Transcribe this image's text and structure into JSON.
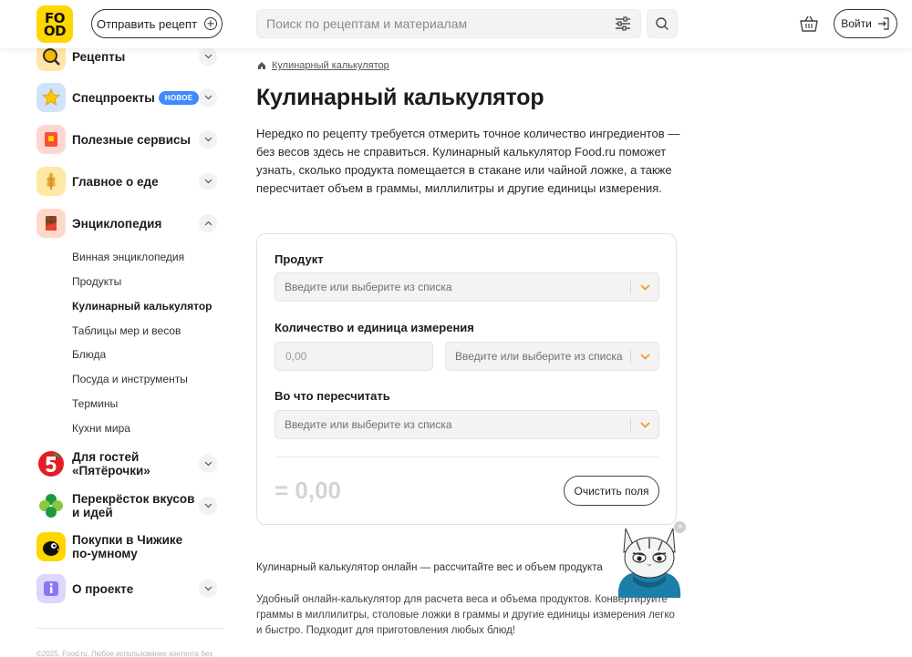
{
  "header": {
    "logo_line1": "FO",
    "logo_line2": "OD",
    "send_recipe_label": "Отправить рецепт",
    "search_placeholder": "Поиск по рецептам и материалам",
    "login_label": "Войти"
  },
  "sidebar": {
    "items": [
      {
        "label": "Рецепты",
        "icon": "recipes-icon"
      },
      {
        "label": "Спецпроекты",
        "icon": "star-icon",
        "badge": "НОВОЕ"
      },
      {
        "label": "Полезные сервисы",
        "icon": "services-icon"
      },
      {
        "label": "Главное о еде",
        "icon": "wheat-icon"
      },
      {
        "label": "Энциклопедия",
        "icon": "chocolate-icon"
      },
      {
        "label_line1": "Для гостей",
        "label_line2": "«Пятёрочки»",
        "icon": "pyaterochka-icon"
      },
      {
        "label_line1": "Перекрёсток вкусов",
        "label_line2": "и идей",
        "icon": "perekrestok-icon"
      },
      {
        "label_line1": "Покупки в Чижике",
        "label_line2": "по-умному",
        "icon": "chizhik-icon"
      },
      {
        "label": "О проекте",
        "icon": "info-icon"
      }
    ],
    "sub_items": [
      "Винная энциклопедия",
      "Продукты",
      "Кулинарный калькулятор",
      "Таблицы мер и весов",
      "Блюда",
      "Посуда и инструменты",
      "Термины",
      "Кухни мира"
    ],
    "copyright": "©2025. Food.ru. Любое использование контента без"
  },
  "main": {
    "breadcrumb": "Кулинарный калькулятор",
    "title": "Кулинарный калькулятор",
    "intro": "Нередко по рецепту требуется отмерить точное количество ингредиентов — без весов здесь не справиться. Кулинарный калькулятор Food.ru поможет узнать, сколько продукта помещается в стакане или чайной ложке, а также пересчитает объем в граммы, миллилитры и другие единицы измерения.",
    "calculator": {
      "product_label": "Продукт",
      "product_placeholder": "Введите или выберите из списка",
      "quantity_label": "Количество и единица измерения",
      "quantity_placeholder": "0,00",
      "unit_placeholder": "Введите или выберите из списка",
      "convert_label": "Во что пересчитать",
      "convert_placeholder": "Введите или выберите из списка",
      "result": "= 0,00",
      "clear_label": "Очистить поля"
    },
    "sub_heading": "Кулинарный калькулятор онлайн — рассчитайте вес и объем продукта",
    "description": "Удобный онлайн-калькулятор для расчета веса и объема продуктов. Конвертируйте граммы в миллилитры, столовые ложки в граммы и другие единицы измерения легко и быстро. Подходит для приготовления любых блюд!"
  },
  "colors": {
    "brand_yellow": "#ffd600",
    "accent_orange": "#f39a1e",
    "badge_blue": "#3e8bff"
  }
}
